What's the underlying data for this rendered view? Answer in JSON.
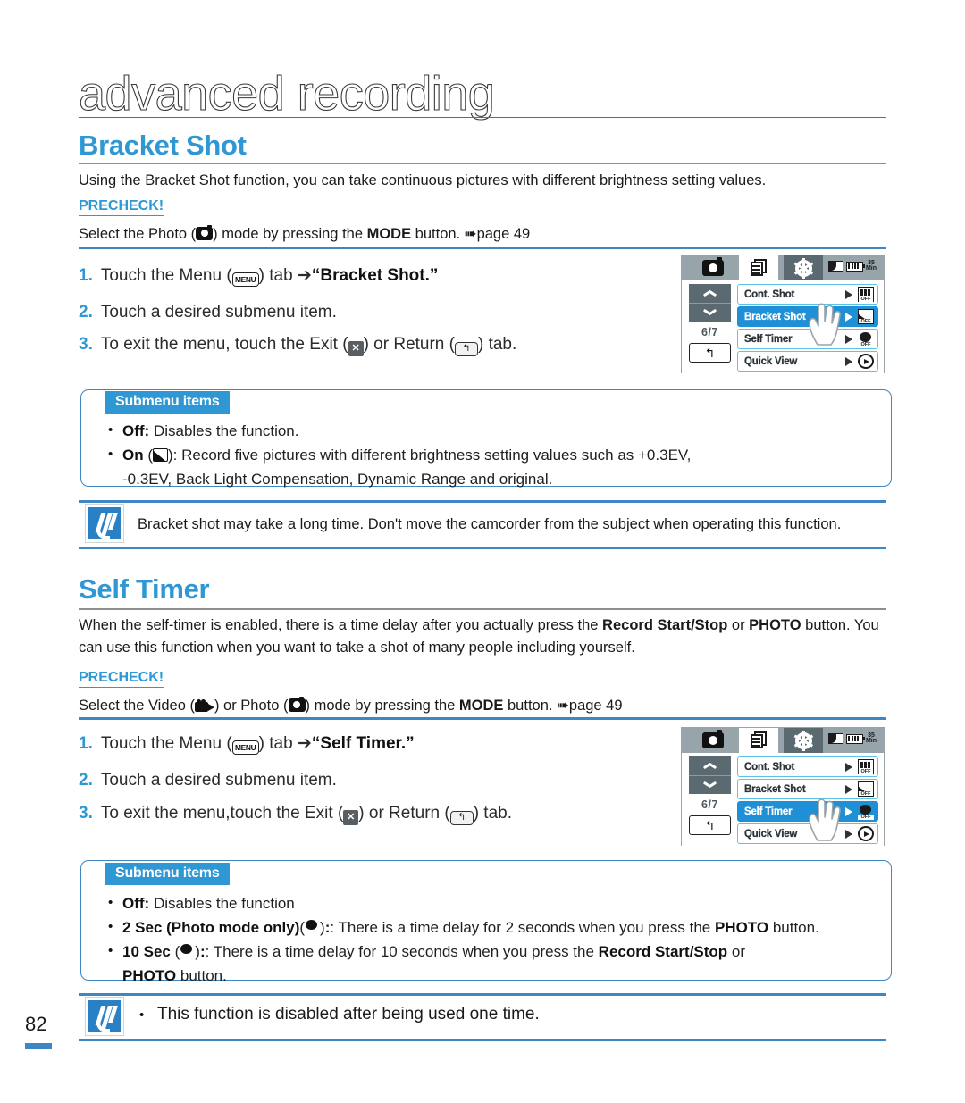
{
  "chapter": {
    "title": "advanced recording"
  },
  "page": {
    "number": "82"
  },
  "sections": [
    {
      "heading": "Bracket Shot",
      "intro": "Using the Bracket Shot function, you can take continuous pictures with different brightness setting values.",
      "precheck_label": "PRECHECK!",
      "precheck_pre": "Select the Photo (",
      "precheck_mid": ") mode by pressing the ",
      "precheck_mode": "MODE",
      "precheck_post": " button. ",
      "precheck_page": "page 49",
      "steps": [
        {
          "num": "1.",
          "pre": "Touch the Menu (",
          "icon": "menu-icon",
          "mid": ") tab ",
          "arrow": "➔",
          "bold": "“Bracket Shot.”",
          "post": ""
        },
        {
          "num": "2.",
          "pre": "Touch a desired submenu item.",
          "icon": "",
          "mid": "",
          "arrow": "",
          "bold": "",
          "post": ""
        },
        {
          "num": "3.",
          "pre": "To exit the menu, touch the Exit (",
          "icon": "exit-icon",
          "mid": ") or Return (",
          "icon2": "return-icon",
          "post": ") tab."
        }
      ],
      "submenu": {
        "tag": "Submenu items",
        "items": [
          {
            "label": "Off:",
            "icon": "",
            "text": " Disables the function."
          },
          {
            "label": "On",
            "icon": "bracket-icon",
            "text": ": Record five pictures with different brightness setting values such as +0.3EV,",
            "cont": "-0.3EV, Back Light Compensation, Dynamic Range and original."
          }
        ]
      },
      "note": "Bracket shot may take a long time. Don't move the camcorder from the subject when operating this function."
    },
    {
      "heading": "Self Timer",
      "intro_line1_a": "When the self-timer is enabled, there is a time delay after you actually press the ",
      "intro_line1_b": "Record Start/Stop",
      "intro_line1_c": " or ",
      "intro_line1_d": "PHOTO",
      "intro_line2": "button. You can use this function when you want to take a shot of many people including yourself.",
      "precheck_label": "PRECHECK!",
      "precheck_pre": "Select the Video (",
      "precheck_mid1": ") or Photo (",
      "precheck_mid2": ") mode by pressing the ",
      "precheck_mode": "MODE",
      "precheck_post": " button. ",
      "precheck_page": "page 49",
      "steps": [
        {
          "num": "1.",
          "pre": "Touch the Menu (",
          "icon": "menu-icon",
          "mid": ") tab ",
          "arrow": "➔",
          "bold": "“Self Timer.”",
          "post": ""
        },
        {
          "num": "2.",
          "pre": "Touch a desired submenu item.",
          "icon": "",
          "mid": "",
          "arrow": "",
          "bold": "",
          "post": ""
        },
        {
          "num": "3.",
          "pre": "To exit the menu,touch the Exit (",
          "icon": "exit-icon",
          "mid": ") or Return (",
          "icon2": "return-icon",
          "post": ") tab."
        }
      ],
      "submenu": {
        "tag": "Submenu items",
        "items": [
          {
            "label": "Off:",
            "text": " Disables the function"
          },
          {
            "label": "2 Sec (Photo mode only)",
            "icon": "timer-icon",
            "text_a": ": There is a time delay for 2 seconds when you press the ",
            "text_b": "PHOTO",
            "text_c": " button."
          },
          {
            "label": "10 Sec",
            "icon": "timer-icon",
            "text_a": ": There is a time delay for 10 seconds when you press the ",
            "text_b": "Record Start/Stop",
            "text_c": " or",
            "cont_b": "PHOTO",
            "cont_c": " button."
          }
        ]
      },
      "note_bullet": "•",
      "note": "This function is disabled after being used one time."
    }
  ],
  "lcd_screens": [
    {
      "tabs": {
        "mode": "camera-icon",
        "list": "menu-list-icon",
        "gear": "settings-gear-icon"
      },
      "indicators": {
        "sd": "sd-card-icon",
        "battery": "battery-icon",
        "time_top": "35",
        "time_bottom": "Min"
      },
      "nav": {
        "up": "chevron-up-icon",
        "down": "chevron-down-icon",
        "count": "6/7",
        "back": "↰"
      },
      "rows": [
        {
          "label": "Cont. Shot",
          "selected": false,
          "icon": "cont-shot-icon",
          "icon_off": "OFF"
        },
        {
          "label": "Bracket Shot",
          "selected": true,
          "icon": "bracket-shot-icon",
          "icon_off": "OFF"
        },
        {
          "label": "Self Timer",
          "selected": false,
          "icon": "self-timer-icon",
          "icon_off": "OFF"
        },
        {
          "label": "Quick View",
          "selected": false,
          "icon": "quick-view-icon",
          "icon_off": ""
        }
      ],
      "hand_on_row": 1
    },
    {
      "tabs": {
        "mode": "camera-icon",
        "list": "menu-list-icon",
        "gear": "settings-gear-icon"
      },
      "indicators": {
        "sd": "sd-card-icon",
        "battery": "battery-icon",
        "time_top": "35",
        "time_bottom": "Min"
      },
      "nav": {
        "up": "chevron-up-icon",
        "down": "chevron-down-icon",
        "count": "6/7",
        "back": "↰"
      },
      "rows": [
        {
          "label": "Cont. Shot",
          "selected": false,
          "icon": "cont-shot-icon",
          "icon_off": "OFF"
        },
        {
          "label": "Bracket Shot",
          "selected": false,
          "icon": "bracket-shot-icon",
          "icon_off": "OFF"
        },
        {
          "label": "Self Timer",
          "selected": true,
          "icon": "self-timer-icon",
          "icon_off": "OFF"
        },
        {
          "label": "Quick View",
          "selected": false,
          "icon": "quick-view-icon",
          "icon_off": ""
        }
      ],
      "hand_on_row": 2
    }
  ],
  "colors": {
    "accent": "#2e97d4",
    "rule": "#3f86c4",
    "lcd_select": "#1f8fd6",
    "lcd_bar": "#97a5ab"
  }
}
